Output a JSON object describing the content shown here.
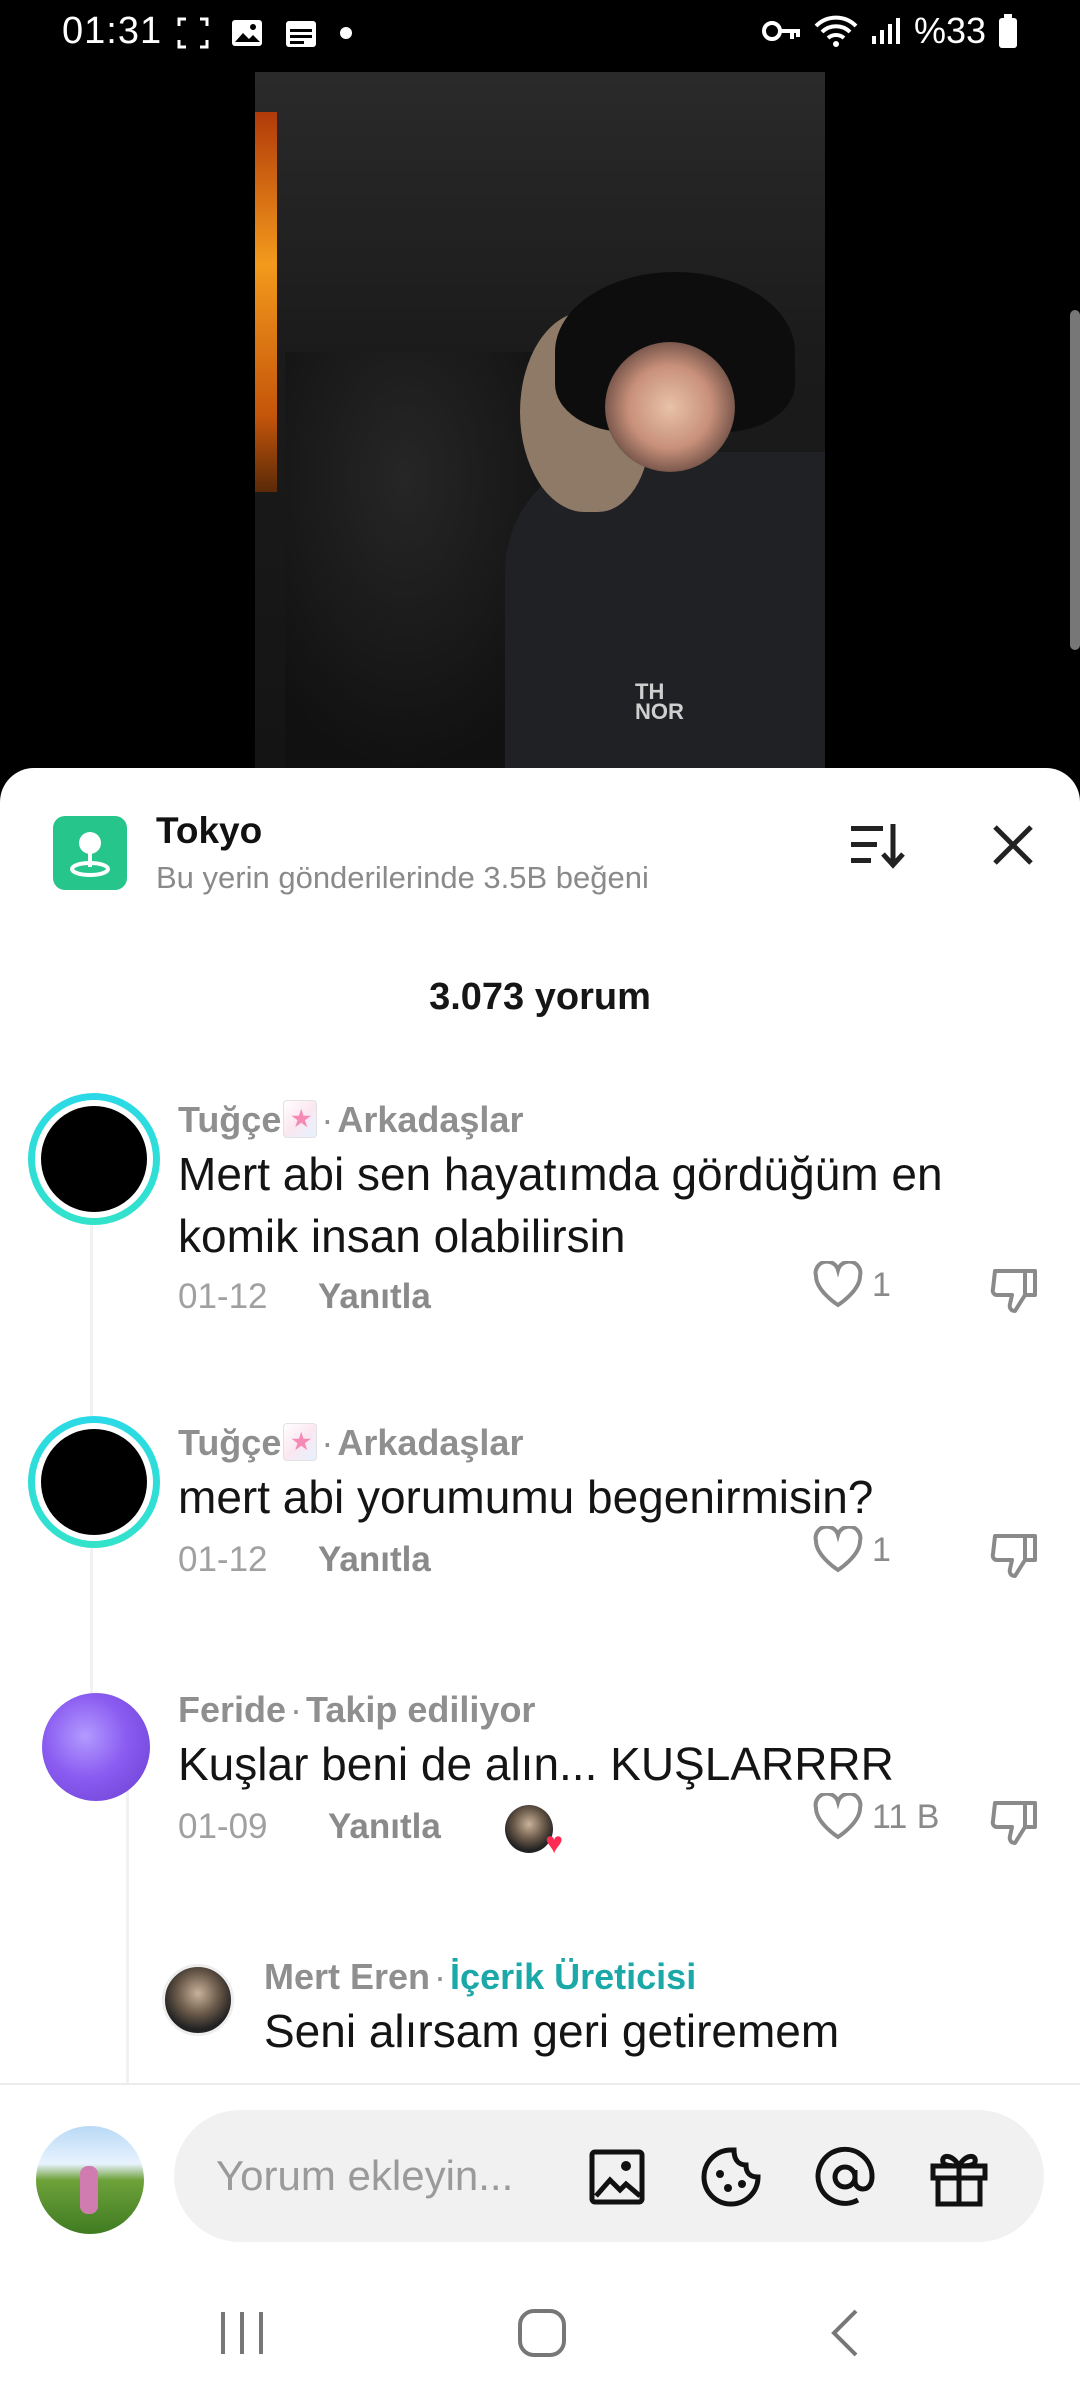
{
  "status_bar": {
    "time": "01:31",
    "battery": "%33"
  },
  "place": {
    "title": "Tokyo",
    "subtitle": "Bu yerin gönderilerinde 3.5B beğeni"
  },
  "video_overlay_text": "TH\nNOR",
  "comments_header": "3.073 yorum",
  "comments": [
    {
      "user": "Tuğçe",
      "relation": "Arkadaşlar",
      "text": "Mert abi sen hayatımda gördüğüm en komik insan olabilirsin",
      "date": "01-12",
      "reply_label": "Yanıtla",
      "likes": "1"
    },
    {
      "user": "Tuğçe",
      "relation": "Arkadaşlar",
      "text": "mert abi yorumumu begenirmisin?",
      "date": "01-12",
      "reply_label": "Yanıtla",
      "likes": "1"
    },
    {
      "user": "Feride",
      "relation": "Takip ediliyor",
      "text": "Kuşlar beni de alın... KUŞLARRRR",
      "date": "01-09",
      "reply_label": "Yanıtla",
      "likes": "11 B"
    }
  ],
  "reply": {
    "user": "Mert Eren",
    "badge": "İçerik Üreticisi",
    "text": "Seni alırsam geri getiremem"
  },
  "input": {
    "placeholder": "Yorum ekleyin..."
  },
  "icons": {
    "place": "location-pin-icon",
    "sort": "sort-icon",
    "close": "close-icon",
    "like": "heart-outline-icon",
    "dislike": "thumbs-down-icon",
    "image": "image-icon",
    "sticker": "emoji-icon",
    "mention": "at-icon",
    "gift": "gift-icon"
  },
  "colors": {
    "place_icon_bg": "#26c58c",
    "story_ring": "#2ad9e8",
    "creator_badge": "#1aa8a8",
    "like_heart": "#fe2c55"
  }
}
